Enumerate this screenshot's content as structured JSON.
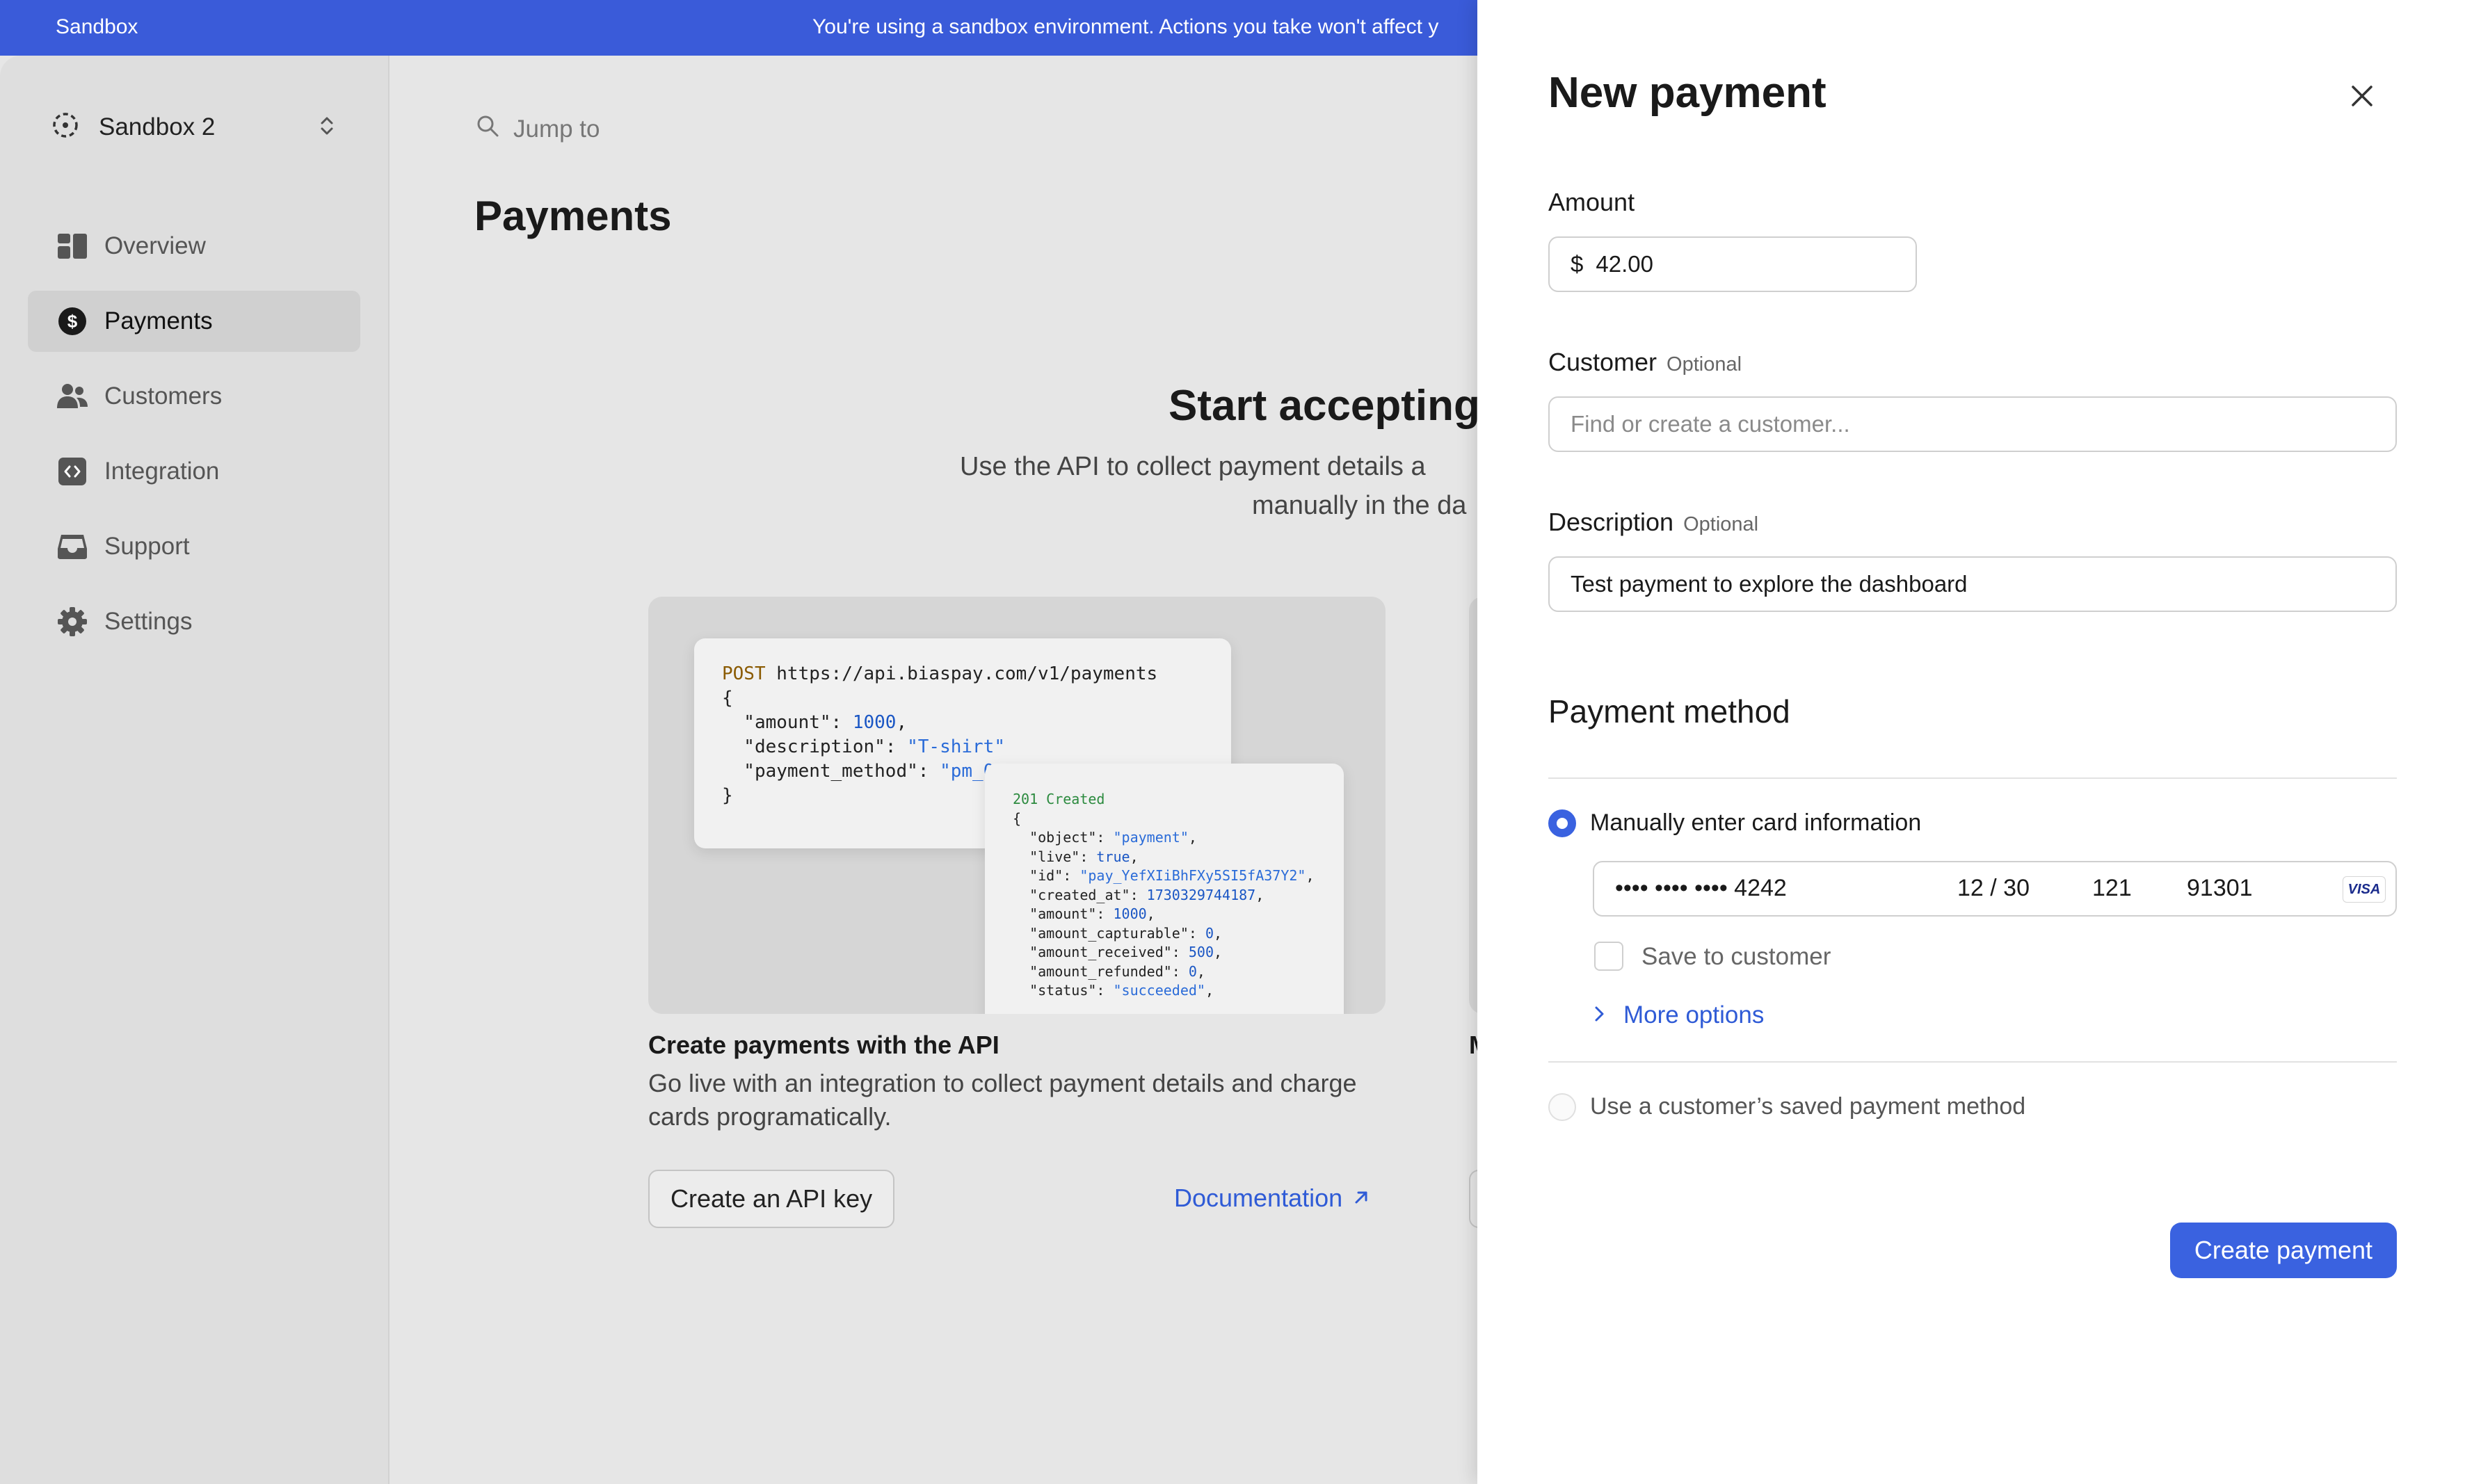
{
  "banner": {
    "label": "Sandbox",
    "message": "You're using a sandbox environment. Actions you take won't affect y"
  },
  "sidebar": {
    "account_name": "Sandbox 2",
    "items": [
      {
        "label": "Overview",
        "icon": "overview-icon"
      },
      {
        "label": "Payments",
        "icon": "dollar-icon",
        "active": true
      },
      {
        "label": "Customers",
        "icon": "users-icon"
      },
      {
        "label": "Integration",
        "icon": "code-icon"
      },
      {
        "label": "Support",
        "icon": "inbox-icon"
      },
      {
        "label": "Settings",
        "icon": "gear-icon"
      }
    ]
  },
  "main": {
    "search_placeholder": "Jump to",
    "page_title": "Payments",
    "hero_title": "Start accepting",
    "hero_sub_line1": "Use the API to collect payment details a",
    "hero_sub_line2": "manually in the da",
    "api_card": {
      "request_method": "POST",
      "request_url": "https://api.biaspay.com/v1/payments",
      "request_body": {
        "amount": "1000",
        "description": "\"T-shirt\"",
        "payment_method": "\"pm_0"
      },
      "response_status": "201 Created",
      "response_body": {
        "object": "\"payment\"",
        "live": "true",
        "id": "\"pay_YefXIiBhFXy5SI5fA37Y2\"",
        "created_at": "1730329744187",
        "amount": "1000",
        "amount_capturable": "0",
        "amount_received": "500",
        "amount_refunded": "0",
        "status": "\"succeeded\""
      },
      "title": "Create payments with the API",
      "description": "Go live with an integration to collect payment details and charge cards programatically.",
      "primary_button": "Create an API key",
      "doc_link": "Documentation"
    },
    "peek_card_letter": "M"
  },
  "drawer": {
    "title": "New payment",
    "amount_label": "Amount",
    "currency_symbol": "$",
    "amount_value": "42.00",
    "customer_label": "Customer",
    "optional_label": "Optional",
    "customer_placeholder": "Find or create a customer...",
    "description_label": "Description",
    "description_value": "Test payment to explore the dashboard",
    "payment_method_title": "Payment method",
    "manual_option": "Manually enter card information",
    "card_number": "•••• •••• •••• 4242",
    "card_expiry": "12 / 30",
    "card_cvc": "121",
    "card_zip": "91301",
    "card_brand": "VISA",
    "save_to_customer": "Save to customer",
    "more_options": "More options",
    "saved_method_option": "Use a customer’s saved payment method",
    "submit_button": "Create payment"
  },
  "colors": {
    "accent": "#3a62e0",
    "banner": "#3a5bd9",
    "link": "#2f5bd6"
  }
}
